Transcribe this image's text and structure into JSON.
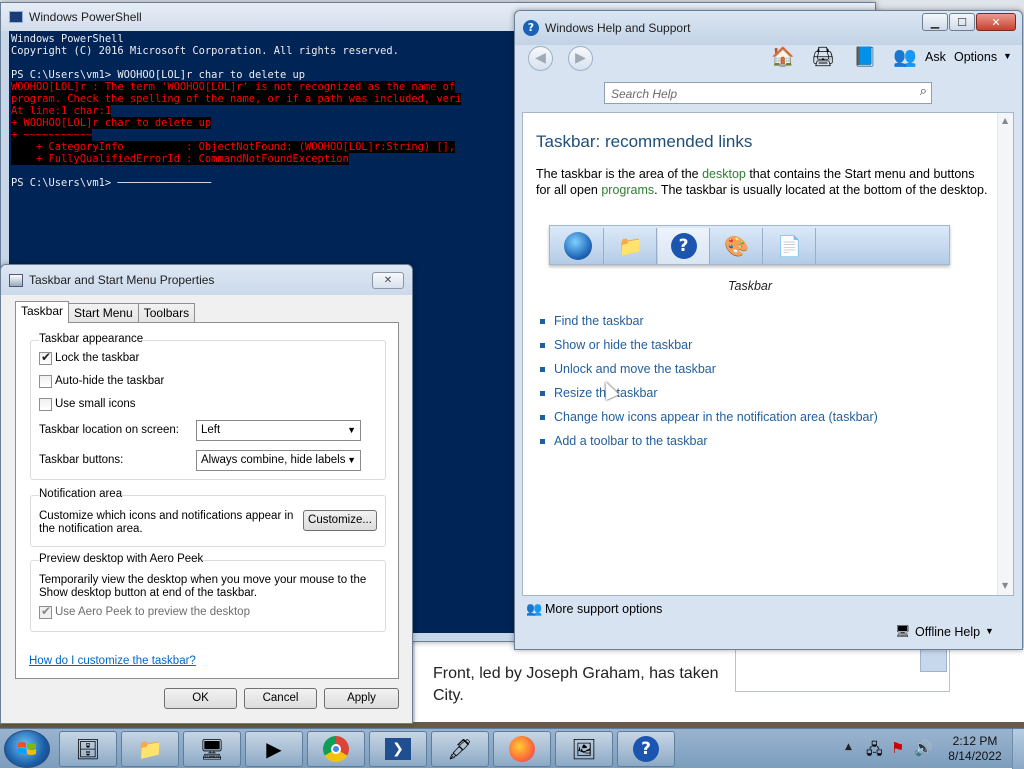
{
  "background": {
    "article_text": "Front, led by Joseph Graham, has taken City."
  },
  "powershell": {
    "title": "Windows PowerShell",
    "lines": [
      {
        "text": "Windows PowerShell",
        "kind": "normal"
      },
      {
        "text": "Copyright (C) 2016 Microsoft Corporation. All rights reserved.",
        "kind": "normal"
      },
      {
        "text": "",
        "kind": "normal"
      },
      {
        "text": "PS C:\\Users\\vm1> WOOHOO[LOL]r char to delete up",
        "kind": "normal"
      },
      {
        "text": "WOOHOO[LOL]r : The term 'WOOHOO[LOL]r' is not recognized as the name of",
        "kind": "err"
      },
      {
        "text": "program. Check the spelling of the name, or if a path was included, veri",
        "kind": "err"
      },
      {
        "text": "At line:1 char:1",
        "kind": "err"
      },
      {
        "text": "+ WOOHOO[LOL]r char to delete up",
        "kind": "err"
      },
      {
        "text": "+ ~~~~~~~~~~~",
        "kind": "err"
      },
      {
        "text": "    + CategoryInfo          : ObjectNotFound: (WOOHOO[LOL]r:String) [],",
        "kind": "err"
      },
      {
        "text": "    + FullyQualifiedErrorId : CommandNotFoundException",
        "kind": "err"
      },
      {
        "text": "",
        "kind": "normal"
      },
      {
        "text": "PS C:\\Users\\vm1> ───────────────",
        "kind": "normal"
      }
    ]
  },
  "taskbar_props": {
    "title": "Taskbar and Start Menu Properties",
    "close_label": "✕",
    "tabs": [
      "Taskbar",
      "Start Menu",
      "Toolbars"
    ],
    "appearance": {
      "group_label": "Taskbar appearance",
      "lock_label": "Lock the taskbar",
      "lock_checked": true,
      "autohide_label": "Auto-hide the taskbar",
      "autohide_checked": false,
      "small_icons_label": "Use small icons",
      "small_icons_checked": false,
      "location_label": "Taskbar location on screen:",
      "location_value": "Left",
      "buttons_label": "Taskbar buttons:",
      "buttons_value": "Always combine, hide labels"
    },
    "notification": {
      "group_label": "Notification area",
      "description": "Customize which icons and notifications appear in the notification area.",
      "customize_label": "Customize..."
    },
    "aero_peek": {
      "group_label": "Preview desktop with Aero Peek",
      "description": "Temporarily view the desktop when you move your mouse to the Show desktop button at end of the taskbar.",
      "checkbox_label": "Use Aero Peek to preview the desktop",
      "checked": true
    },
    "help_link": "How do I customize the taskbar?",
    "ok_label": "OK",
    "cancel_label": "Cancel",
    "apply_label": "Apply"
  },
  "help_support": {
    "title": "Windows Help and Support",
    "ask_label": "Ask",
    "options_label": "Options",
    "search_placeholder": "Search Help",
    "page_title": "Taskbar: recommended links",
    "para_1": "The taskbar is the area of the ",
    "para_link_1": "desktop",
    "para_2": " that contains the Start menu and buttons for all open ",
    "para_link_2": "programs",
    "para_3": ". The taskbar is usually located at the bottom of the desktop.",
    "image_caption": "Taskbar",
    "links": [
      "Find the taskbar",
      "Show or hide the taskbar",
      "Unlock and move the taskbar",
      "Resize the taskbar",
      "Change how icons appear in the notification area (taskbar)",
      "Add a toolbar to the taskbar"
    ],
    "more_support": "More support options",
    "offline_help": "Offline Help"
  },
  "taskbar": {
    "time": "2:12 PM",
    "date": "8/14/2022",
    "items": [
      "server-manager-icon",
      "folder-icon",
      "control-panel-icon",
      "media-player-icon",
      "chrome-icon",
      "powershell-icon",
      "inkscape-icon",
      "firefox-icon",
      "photo-viewer-icon",
      "help-icon"
    ]
  }
}
